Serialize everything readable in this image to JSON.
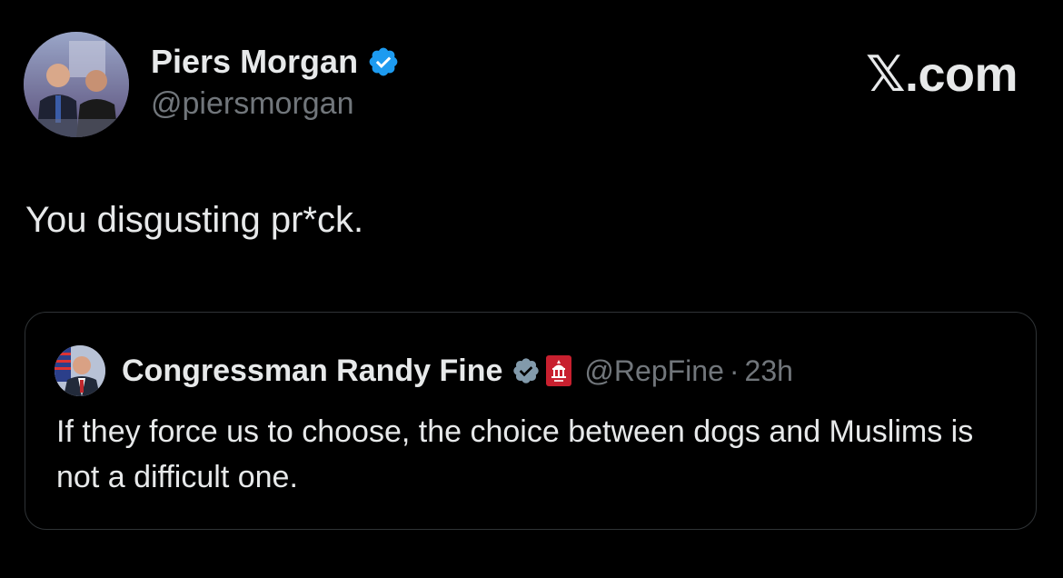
{
  "tweet": {
    "author": {
      "name": "Piers Morgan",
      "handle": "@piersmorgan",
      "verified_color": "#1d9bf0"
    },
    "brand": "𝕏.com",
    "text": "You disgusting pr*ck."
  },
  "quote": {
    "author": {
      "name": "Congressman Randy Fine",
      "handle": "@RepFine",
      "verified_color": "#829aab",
      "affiliation_icon": "house-gop-badge-icon"
    },
    "separator": "·",
    "time": "23h",
    "text": "If they force us to choose, the choice between dogs and Muslims is not a difficult one."
  },
  "colors": {
    "background": "#000000",
    "text_primary": "#e7e9ea",
    "text_secondary": "#71767b",
    "card_border": "#2f3336"
  }
}
